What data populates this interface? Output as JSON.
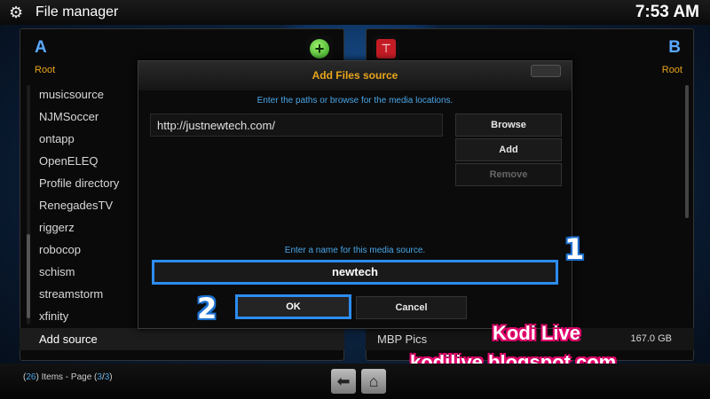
{
  "app": {
    "title": "File manager",
    "clock": "7:53 AM"
  },
  "pane_a": {
    "letter": "A",
    "root": "Root",
    "items": [
      "musicsource",
      "NJMSoccer",
      "ontapp",
      "OpenELEQ",
      "Profile directory",
      "RenegadesTV",
      "riggerz",
      "robocop",
      "schism",
      "streamstorm",
      "xfinity"
    ],
    "add_source": "Add source"
  },
  "pane_b": {
    "letter": "B",
    "root": "Root",
    "item": {
      "name": "MBP Pics",
      "size": "167.0 GB"
    }
  },
  "dialog": {
    "title": "Add Files source",
    "close_label": "",
    "instruction_paths": "Enter the paths or browse for the media locations.",
    "path": "http://justnewtech.com/",
    "browse_label": "Browse",
    "add_label": "Add",
    "remove_label": "Remove",
    "instruction_name": "Enter a name for this media source.",
    "name_value": "newtech",
    "ok_label": "OK",
    "cancel_label": "Cancel"
  },
  "markers": {
    "one": "1",
    "two": "2"
  },
  "watermark": {
    "title": "Kodi Live",
    "url": "kodilive.blogspot.com"
  },
  "footer": {
    "items_count": "26",
    "page_current": "3",
    "page_total": "3"
  },
  "icons": {
    "settings": "gear-icon",
    "add": "plus-circle-icon",
    "network": "network-drive-icon",
    "back": "back-arrow-icon",
    "home": "home-icon"
  },
  "colors": {
    "accent_blue": "#2c8cf0",
    "title_orange": "#e8a41b",
    "watermark_pink": "#e0006a"
  }
}
